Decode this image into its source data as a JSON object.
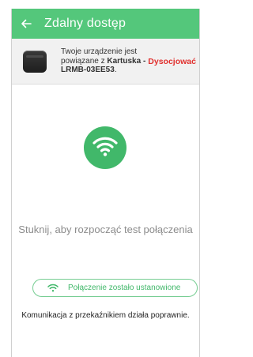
{
  "appbar": {
    "title": "Zdalny dostęp",
    "back_icon": "arrow-left-icon",
    "color": "#54c77b"
  },
  "device": {
    "text_before": "Twoje urządzenie jest powiązane z ",
    "device_name": "Kartuska - LRMB-03EE53",
    "text_after": ".",
    "disconnect_label": "Dysocjować",
    "disconnect_color": "#e1302e"
  },
  "main": {
    "wifi_icon": "wifi-icon",
    "tap_prompt": "Stuknij, aby rozpocząć test połączenia",
    "status_label": "Połączenie zostało ustanowione",
    "status_icon": "wifi-icon",
    "communication_message": "Komunikacja z przekaźnikiem działa poprawnie.",
    "accent_color": "#41b86a"
  }
}
